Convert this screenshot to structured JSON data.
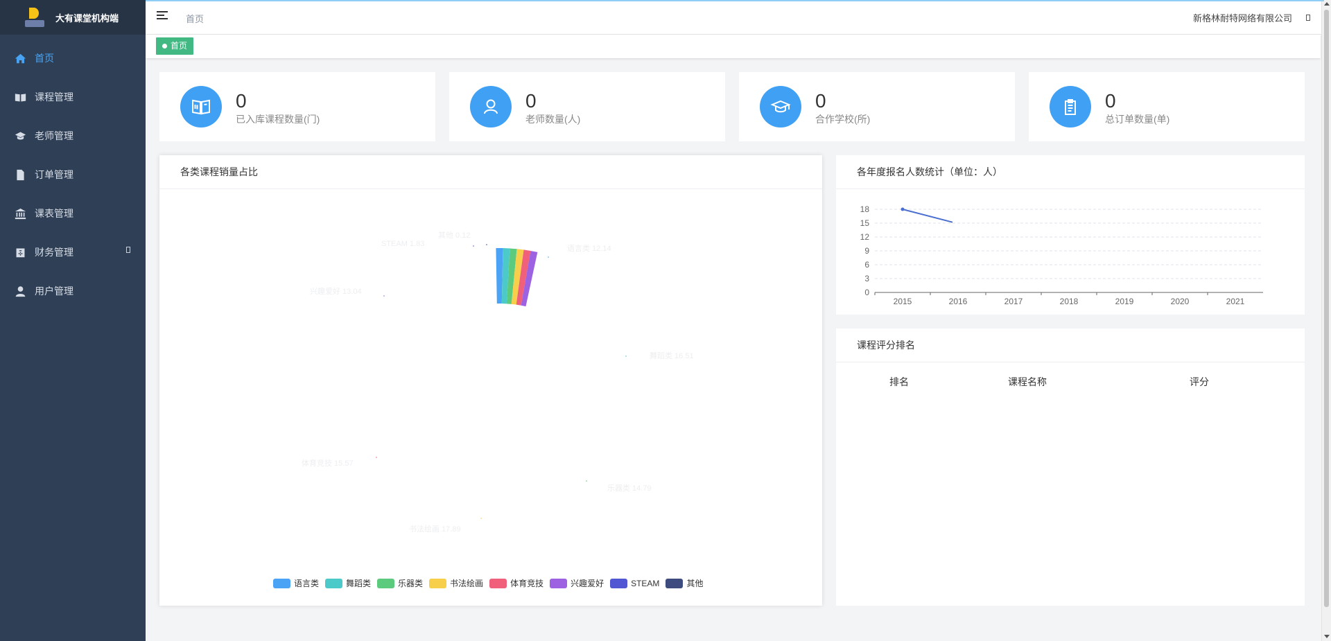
{
  "brand": {
    "title": "大有课堂机构端"
  },
  "sidebar": {
    "items": [
      {
        "label": "首页",
        "icon": "home-icon"
      },
      {
        "label": "课程管理",
        "icon": "book-icon"
      },
      {
        "label": "老师管理",
        "icon": "graduation-cap-icon"
      },
      {
        "label": "订单管理",
        "icon": "document-icon"
      },
      {
        "label": "课表管理",
        "icon": "institution-icon"
      },
      {
        "label": "财务管理",
        "icon": "money-box-icon"
      },
      {
        "label": "用户管理",
        "icon": "user-icon"
      }
    ]
  },
  "header": {
    "breadcrumb": "首页",
    "company": "新格林耐特网络有限公司"
  },
  "tags": [
    {
      "label": "首页"
    }
  ],
  "stats": [
    {
      "value": "0",
      "label": "已入库课程数量(门)",
      "icon": "book-open-icon"
    },
    {
      "value": "0",
      "label": "老师数量(人)",
      "icon": "teacher-icon"
    },
    {
      "value": "0",
      "label": "合作学校(所)",
      "icon": "graduation-cap-icon"
    },
    {
      "value": "0",
      "label": "总订单数量(单)",
      "icon": "clipboard-icon"
    }
  ],
  "pie_panel": {
    "title": "各类课程销量占比"
  },
  "line_panel": {
    "title": "各年度报名人数统计（单位：人）"
  },
  "rank_panel": {
    "title": "课程评分排名",
    "columns": [
      "排名",
      "课程名称",
      "评分"
    ]
  },
  "colors": {
    "accent": "#40a0f3",
    "sidebar": "#2f3f55",
    "tag": "#42b983"
  },
  "chart_data": [
    {
      "type": "pie",
      "title": "各类课程销量占比",
      "categories": [
        "语言类",
        "舞蹈类",
        "乐器类",
        "书法绘画",
        "体育竞技",
        "兴趣爱好",
        "STEAM",
        "其他"
      ],
      "values": [
        12.14,
        16.51,
        14.79,
        17.89,
        15.57,
        13.04,
        1.83,
        0.12
      ],
      "labels": [
        "语言类 12.14",
        "舞蹈类 16.51",
        "乐器类 14.79",
        "书法绘画 17.89",
        "体育竞技 15.57",
        "兴趣爱好 13.04",
        "STEAM 1.83",
        "其他 0.12"
      ],
      "colors": [
        "#4aa3f5",
        "#4cc9c9",
        "#5ccb7d",
        "#f7cf4a",
        "#f0607a",
        "#9d62e2",
        "#5157d2",
        "#3d4b7e"
      ],
      "legend": "bottom"
    },
    {
      "type": "line",
      "title": "各年度报名人数统计（单位：人）",
      "x": [
        "2015",
        "2016",
        "2017",
        "2018",
        "2019",
        "2020",
        "2021"
      ],
      "y_ticks": [
        "18",
        "15",
        "12",
        "9",
        "6",
        "3",
        "0"
      ],
      "ylim": [
        0,
        18
      ],
      "series": [
        {
          "color": "#4a6fd1",
          "values": [
            18,
            15.2
          ]
        }
      ],
      "grid": true
    }
  ]
}
